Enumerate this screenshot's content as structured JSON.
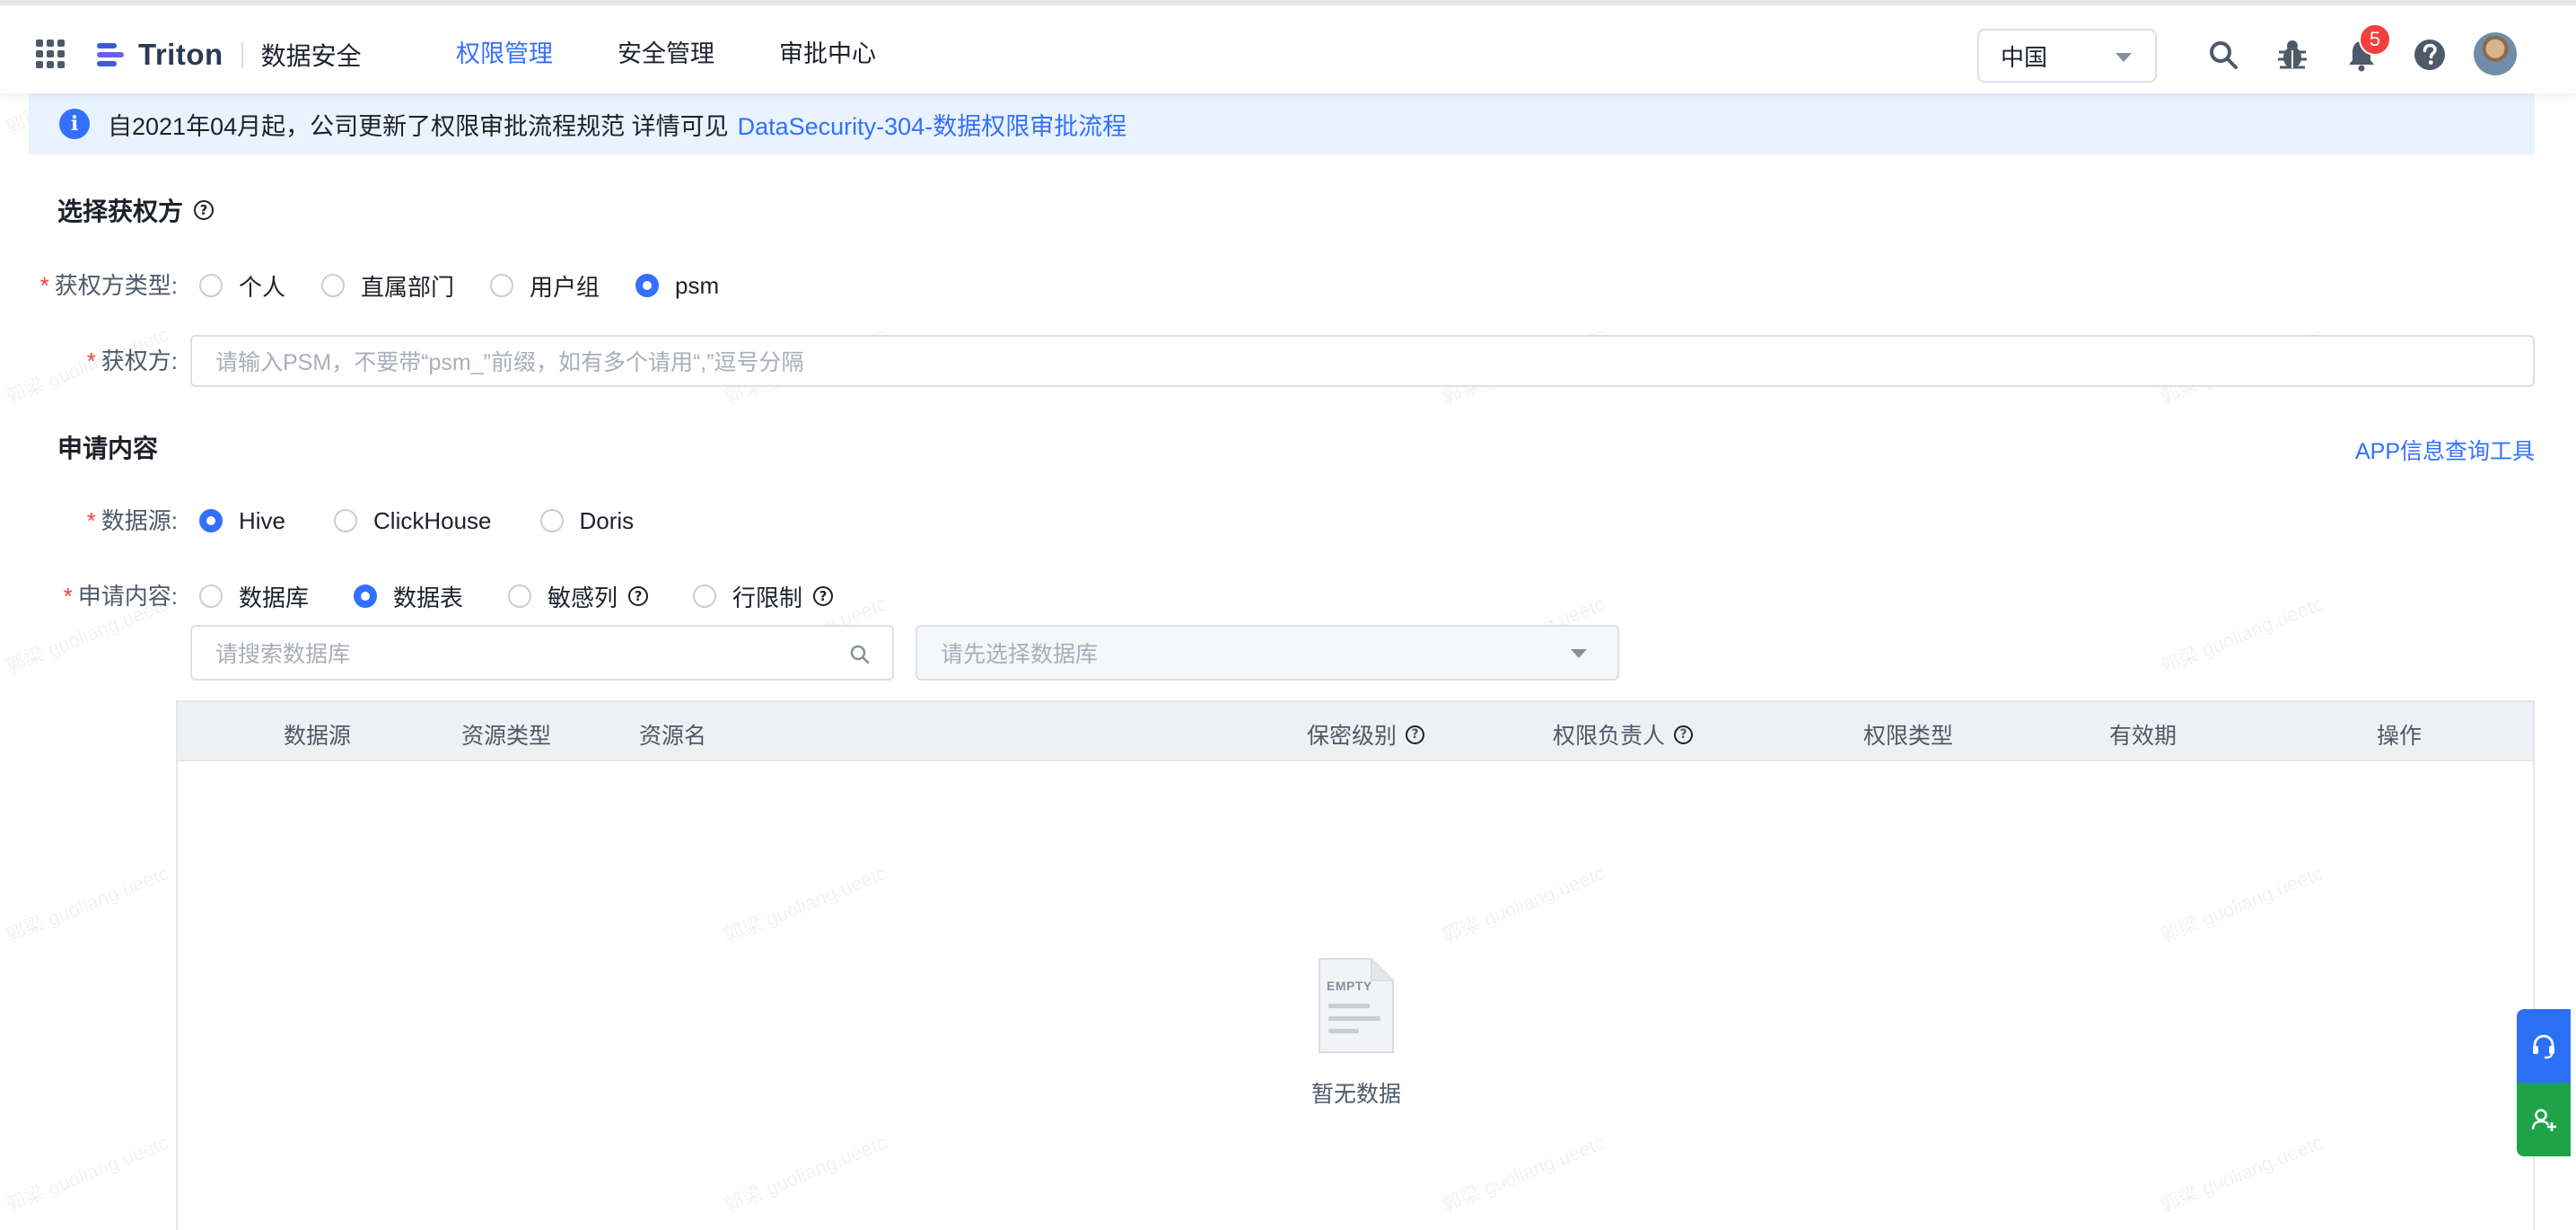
{
  "topbar": {
    "brand": "Triton",
    "product": "数据安全",
    "nav": [
      {
        "label": "权限管理",
        "active": true
      },
      {
        "label": "安全管理",
        "active": false
      },
      {
        "label": "审批中心",
        "active": false
      }
    ],
    "region": "中国",
    "notification_count": "5"
  },
  "notice": {
    "text": "自2021年04月起，公司更新了权限审批流程规范 详情可见",
    "link": "DataSecurity-304-数据权限审批流程"
  },
  "grantee_section": {
    "title": "选择获权方",
    "type_label": "获权方类型:",
    "type_options": [
      "个人",
      "直属部门",
      "用户组",
      "psm"
    ],
    "type_selected": "psm",
    "grantee_label": "获权方:",
    "grantee_placeholder": "请输入PSM，不要带“psm_”前缀，如有多个请用“,”逗号分隔"
  },
  "content_section": {
    "title": "申请内容",
    "tool_link": "APP信息查询工具",
    "source_label": "数据源:",
    "source_options": [
      "Hive",
      "ClickHouse",
      "Doris"
    ],
    "source_selected": "Hive",
    "content_label": "申请内容:",
    "content_options": [
      "数据库",
      "数据表",
      "敏感列",
      "行限制"
    ],
    "content_selected": "数据表",
    "db_search_placeholder": "请搜索数据库",
    "table_select_placeholder": "请先选择数据库"
  },
  "table": {
    "columns": [
      "数据源",
      "资源类型",
      "资源名",
      "保密级别",
      "权限负责人",
      "权限类型",
      "有效期",
      "操作"
    ],
    "empty_badge": "EMPTY",
    "empty_text": "暂无数据"
  },
  "watermark": "郭梁 guoliang.ueetc",
  "colors": {
    "primary": "#3370ff",
    "required": "#f53f3f",
    "notice_bg": "#e8f3ff",
    "chat_btn": "#2b70f5",
    "contact_btn": "#1fa34a"
  }
}
